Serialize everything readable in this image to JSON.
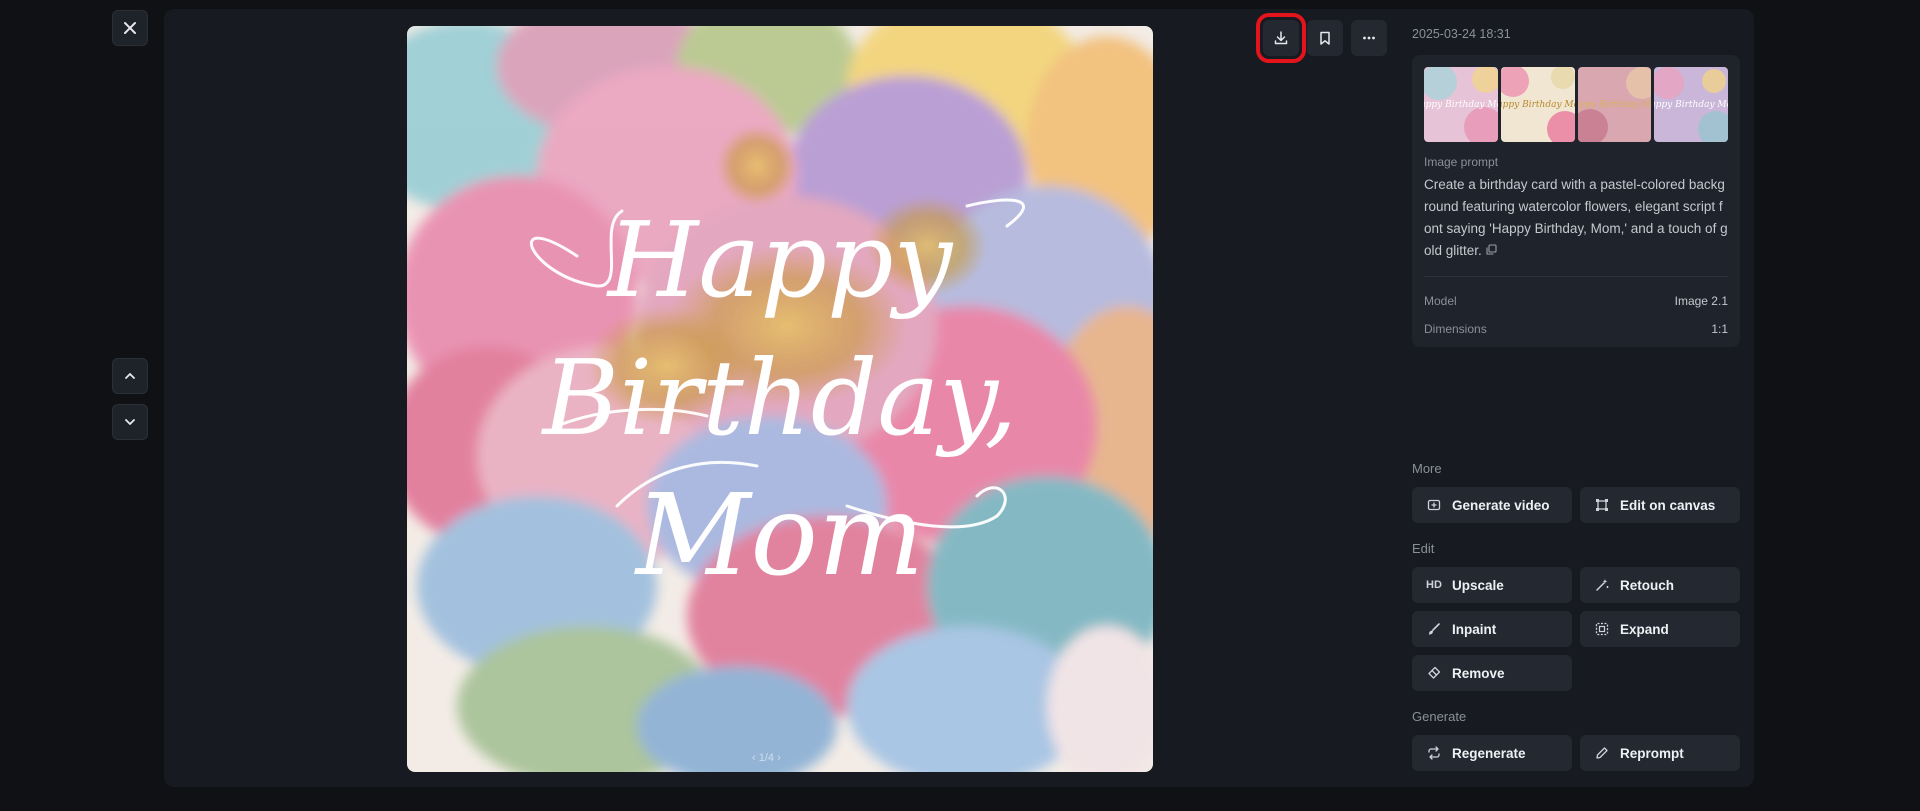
{
  "image_meta": {
    "date": "2025-03-24 18:31",
    "prompt_label": "Image prompt",
    "prompt": "Create a birthday card with a pastel-colored background featuring watercolor flowers, elegant script font saying 'Happy Birthday, Mom,' and a touch of gold glitter.",
    "model_label": "Model",
    "model_value": "Image 2.1",
    "dimensions_label": "Dimensions",
    "dimensions_value": "1:1"
  },
  "artwork": {
    "line1": "Happy",
    "line2": "Birthday,",
    "line3": "Mom",
    "page_indicator": "‹ 1/4 ›"
  },
  "thumbnails": [
    {
      "text": "Happy Birthday Mom",
      "bg": "#e7c3d7"
    },
    {
      "text": "Happy Birthday Mom",
      "bg": "#e9d7a8"
    },
    {
      "text": "Happy Birthday Mom",
      "bg": "#d9a7b0"
    },
    {
      "text": "Happy Birthday Mom",
      "bg": "#c9b6d9"
    }
  ],
  "sections": {
    "more": "More",
    "edit": "Edit",
    "generate": "Generate"
  },
  "actions": {
    "generate_video": "Generate video",
    "edit_on_canvas": "Edit on canvas",
    "upscale_badge": "HD",
    "upscale": "Upscale",
    "retouch": "Retouch",
    "inpaint": "Inpaint",
    "expand": "Expand",
    "remove": "Remove",
    "regenerate": "Regenerate",
    "reprompt": "Reprompt"
  },
  "icons": {
    "close": "close-icon",
    "up": "chevron-up-icon",
    "down": "chevron-down-icon",
    "download": "download-icon",
    "bookmark": "bookmark-icon",
    "more": "more-horizontal-icon",
    "copy": "copy-icon"
  },
  "colors": {
    "background": "#0f1115",
    "panel": "#171a20",
    "button": "#232831",
    "highlight": "#e3141b"
  }
}
